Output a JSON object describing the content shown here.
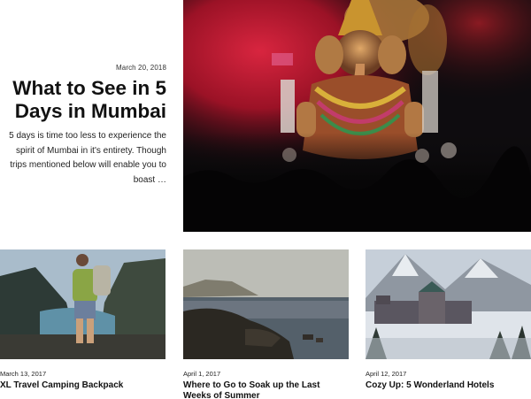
{
  "featured": {
    "date": "March 20, 2018",
    "title": "What to See in 5 Days in Mumbai",
    "excerpt": "5 days is time too less to experience the spirit of Mumbai in it's entirety. Though trips mentioned below will enable you to boast …",
    "image_icon": "ganesha-festival-photo"
  },
  "posts": [
    {
      "date": "March 13, 2017",
      "title": "XL Travel Camping Backpack",
      "image_icon": "hiker-backpack-photo"
    },
    {
      "date": "April 1, 2017",
      "title": "Where to Go to Soak up the Last Weeks of Summer",
      "image_icon": "rocky-coast-photo"
    },
    {
      "date": "April 12, 2017",
      "title": "Cozy Up: 5 Wonderland Hotels",
      "image_icon": "mountain-hotel-photo"
    }
  ]
}
